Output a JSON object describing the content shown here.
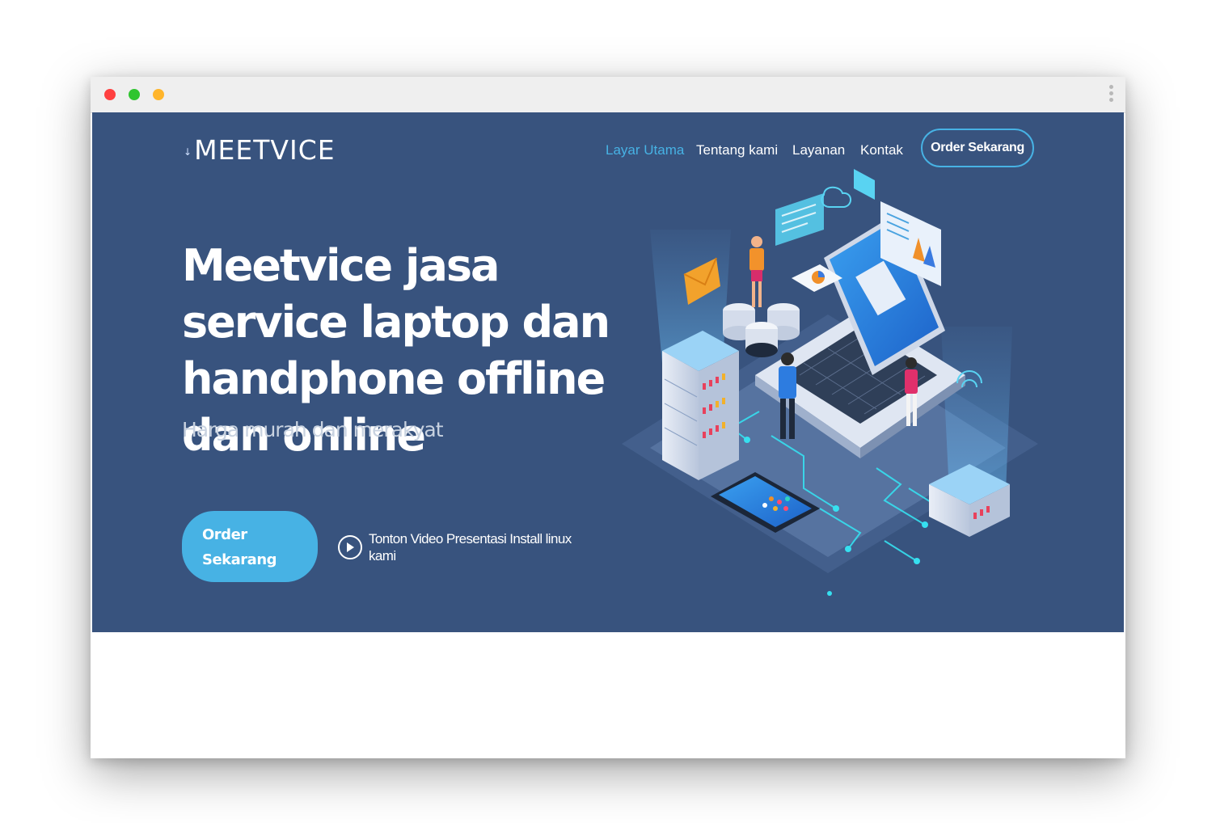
{
  "brand": {
    "name": "MEETVICE"
  },
  "nav": {
    "items": [
      {
        "label": "Layar Utama",
        "active": true
      },
      {
        "label": "Tentang kami",
        "active": false
      },
      {
        "label": "Layanan",
        "active": false
      },
      {
        "label": "Kontak",
        "active": false
      }
    ],
    "order_button": "Order Sekarang"
  },
  "hero": {
    "headline": "Meetvice jasa service laptop dan handphone offline dan online",
    "subtitle": "Harga murah dan merakyat",
    "cta_label": "Order Sekarang",
    "video_label": "Tonton Video Presentasi Install linux kami"
  },
  "colors": {
    "hero_bg": "#38537e",
    "accent": "#47b2e4",
    "window_dots": [
      "#ff4040",
      "#2fc52f",
      "#ffb52b"
    ]
  }
}
